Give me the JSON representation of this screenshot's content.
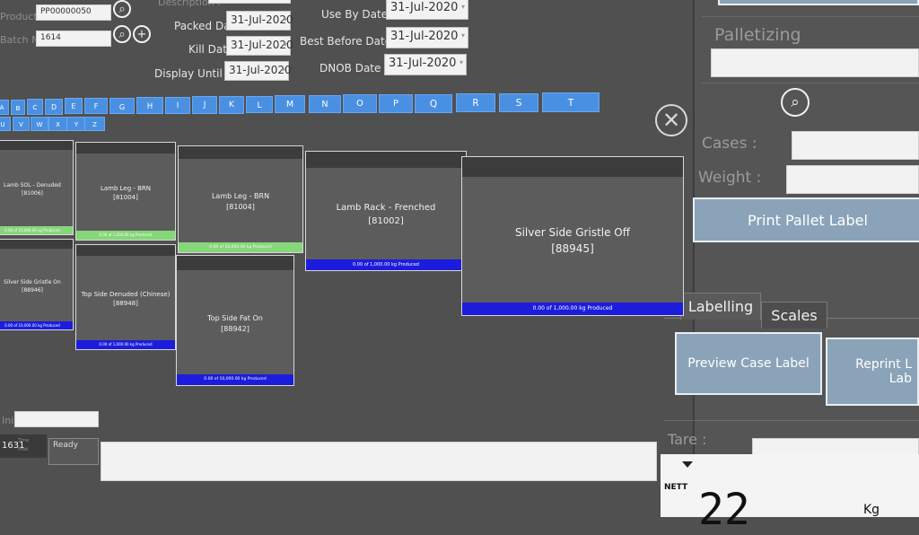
{
  "header": {
    "production_order_label": "Production Order",
    "production_order_value": "PP00000050",
    "batch_label": "Batch No :",
    "batch_value": "1614",
    "description_label": "Description :",
    "packed_date_label": "Packed Date :",
    "packed_date": "31-Jul-2020",
    "kill_date_label": "Kill Date :",
    "kill_date": "31-Jul-2020",
    "display_until_label": "Display Until Date :",
    "display_until": "31-Jul-2020",
    "use_by_label": "Use By Date :",
    "use_by": "31-Jul-2020",
    "best_before_label": "Best Before Date :",
    "best_before": "31-Jul-2020",
    "dnob_label": "DNOB Date :",
    "dnob": "31-Jul-2020"
  },
  "alphabet_row1": [
    "A",
    "B",
    "C",
    "D",
    "E",
    "F",
    "G",
    "H",
    "I",
    "J",
    "K",
    "L",
    "M",
    "N",
    "O",
    "P",
    "Q",
    "R",
    "S",
    "T"
  ],
  "alphabet_row2": [
    "U",
    "V",
    "W",
    "X",
    "Y",
    "Z"
  ],
  "products": [
    {
      "name": "Lamb SOL - Denuded",
      "code": "[81006]",
      "progress": "0.00 of 10,000.00 kg Produced",
      "status": "green"
    },
    {
      "name": "Lamb Leg - BRN",
      "code": "[81004]",
      "progress": "0.00 of 1,000.00 kg Produced",
      "status": "green"
    },
    {
      "name": "Lamb Leg - BRN",
      "code": "[81004]",
      "progress": "0.00 of 10,000.00 kg Produced",
      "status": "green"
    },
    {
      "name": "Lamb Rack - Frenched",
      "code": "[81002]",
      "progress": "0.00 of 1,000.00 kg Produced",
      "status": "blue"
    },
    {
      "name": "Silver Side Gristle Off",
      "code": "[88945]",
      "progress": "0.00 of 1,000.00 kg Produced",
      "status": "blue"
    },
    {
      "name": "Silver Side Gristle On",
      "code": "[88946]",
      "progress": "0.00 of 10,000.00 kg Produced",
      "status": "blue"
    },
    {
      "name": "Top Side Denuded (Chinese)",
      "code": "[88948]",
      "progress": "0.00 of 1,000.00 kg Produced",
      "status": "blue"
    },
    {
      "name": "Top Side Fat On",
      "code": "[88942]",
      "progress": "0.00 of 10,000.00 kg Produced",
      "status": "blue"
    }
  ],
  "footer": {
    "left_label": "Init",
    "time": "1631",
    "small_1": "Time",
    "small_2": "Prod",
    "status_text": "Ready"
  },
  "right_panel": {
    "palletizing_label": "Palletizing",
    "cases_label": "Cases :",
    "weight_label": "Weight :",
    "print_pallet_label": "Print Pallet Label",
    "tabs": [
      "Labelling",
      "Scales"
    ],
    "preview_case_label": "Preview Case Label",
    "reprint_label_1": "Reprint L",
    "reprint_label_2": "Lab",
    "tare_label": "Tare :",
    "nett_label": "NETT",
    "scale_value": "22",
    "scale_unit": "Kg"
  },
  "colors": {
    "letter_button": "#4a90e2",
    "progress_green": "#86d67a",
    "progress_blue": "#1c1cdc",
    "action_button": "#8aa3b8"
  }
}
